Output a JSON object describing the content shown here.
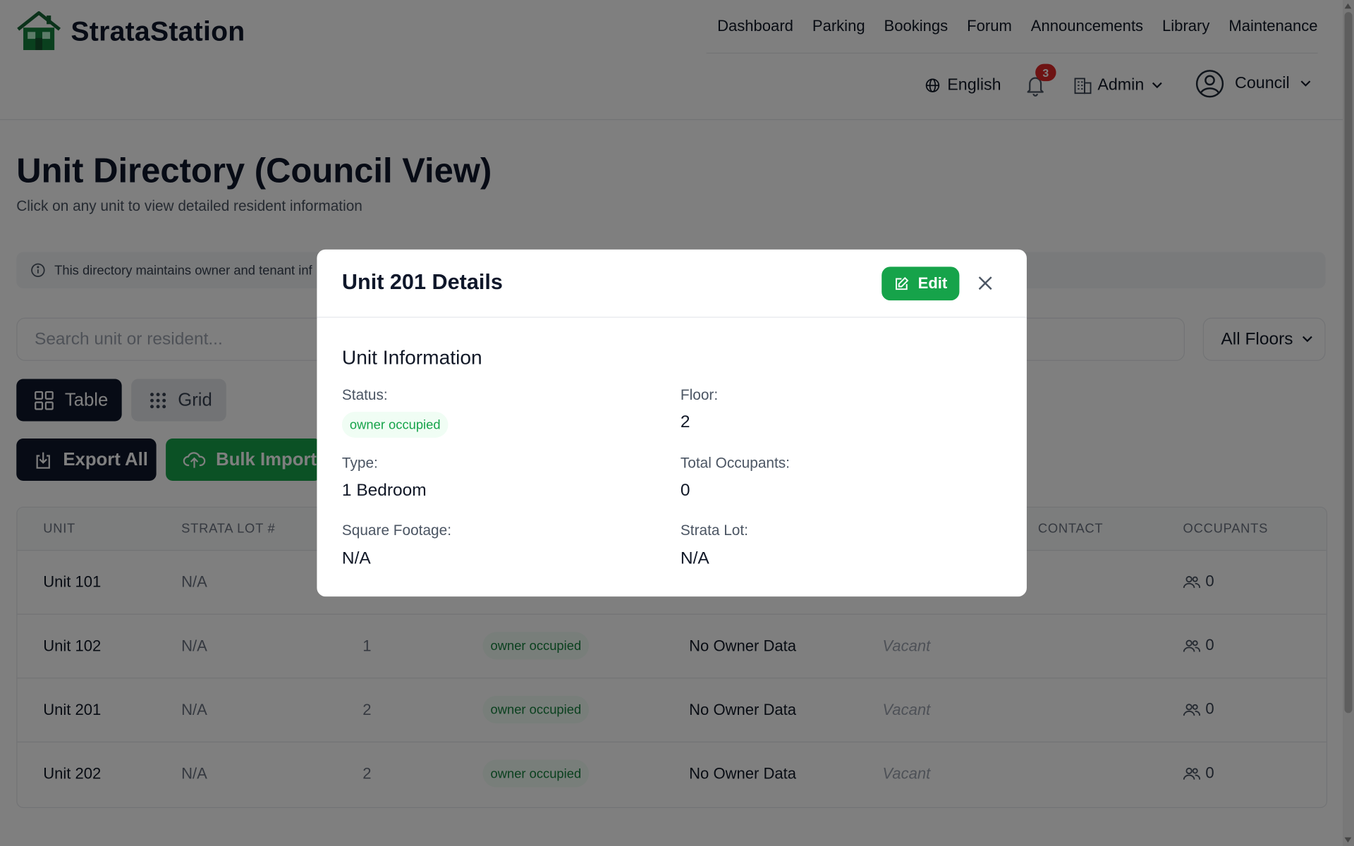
{
  "brand": {
    "name": "StrataStation"
  },
  "nav": [
    {
      "label": "Dashboard"
    },
    {
      "label": "Parking"
    },
    {
      "label": "Bookings"
    },
    {
      "label": "Forum"
    },
    {
      "label": "Announcements"
    },
    {
      "label": "Library"
    },
    {
      "label": "Maintenance"
    }
  ],
  "toolbar": {
    "language": "English",
    "notifications_count": "3",
    "building": "Admin",
    "user_role": "Council"
  },
  "page": {
    "title": "Unit Directory (Council View)",
    "subtitle": "Click on any unit to view detailed resident information",
    "info_banner": "This directory maintains owner and tenant inf"
  },
  "search": {
    "placeholder": "Search unit or resident..."
  },
  "floor_filter": {
    "value": "All Floors"
  },
  "view_toggle": {
    "table_label": "Table",
    "grid_label": "Grid",
    "active": "Table"
  },
  "actions": {
    "export_label": "Export All",
    "import_label": "Bulk Import"
  },
  "table": {
    "columns": [
      "UNIT",
      "STRATA LOT #",
      "CONTACT",
      "OCCUPANTS"
    ],
    "rows": [
      {
        "unit": "Unit 101",
        "strata_lot": "N/A",
        "floor": "",
        "status": "",
        "owner": "",
        "contact": "",
        "occupants": "0"
      },
      {
        "unit": "Unit 102",
        "strata_lot": "N/A",
        "floor": "1",
        "status": "owner occupied",
        "owner": "No Owner Data",
        "contact": "Vacant",
        "occupants": "0"
      },
      {
        "unit": "Unit 201",
        "strata_lot": "N/A",
        "floor": "2",
        "status": "owner occupied",
        "owner": "No Owner Data",
        "contact": "Vacant",
        "occupants": "0"
      },
      {
        "unit": "Unit 202",
        "strata_lot": "N/A",
        "floor": "2",
        "status": "owner occupied",
        "owner": "No Owner Data",
        "contact": "Vacant",
        "occupants": "0"
      }
    ]
  },
  "modal": {
    "title": "Unit 201 Details",
    "edit_label": "Edit",
    "section_title": "Unit Information",
    "fields": {
      "status_label": "Status:",
      "status_value": "owner occupied",
      "floor_label": "Floor:",
      "floor_value": "2",
      "type_label": "Type:",
      "type_value": "1 Bedroom",
      "occupants_label": "Total Occupants:",
      "occupants_value": "0",
      "sqft_label": "Square Footage:",
      "sqft_value": "N/A",
      "strata_lot_label": "Strata Lot:",
      "strata_lot_value": "N/A"
    }
  },
  "colors": {
    "primary_dark": "#0f172a",
    "accent_green": "#16a34a",
    "badge_red": "#dc2626",
    "status_pill_bg": "#f0fdf4",
    "overlay": "rgba(0,0,0,0.5)"
  },
  "icons": {
    "logo": "house-logo-icon",
    "language": "globe-icon",
    "notifications": "bell-icon",
    "building": "building-icon",
    "user": "user-circle-icon",
    "info": "info-icon",
    "table_view": "grid-2x2-icon",
    "grid_view": "dots-grid-icon",
    "export": "download-icon",
    "import": "cloud-upload-icon",
    "occupants": "users-icon",
    "edit": "edit-icon",
    "close": "close-icon"
  }
}
